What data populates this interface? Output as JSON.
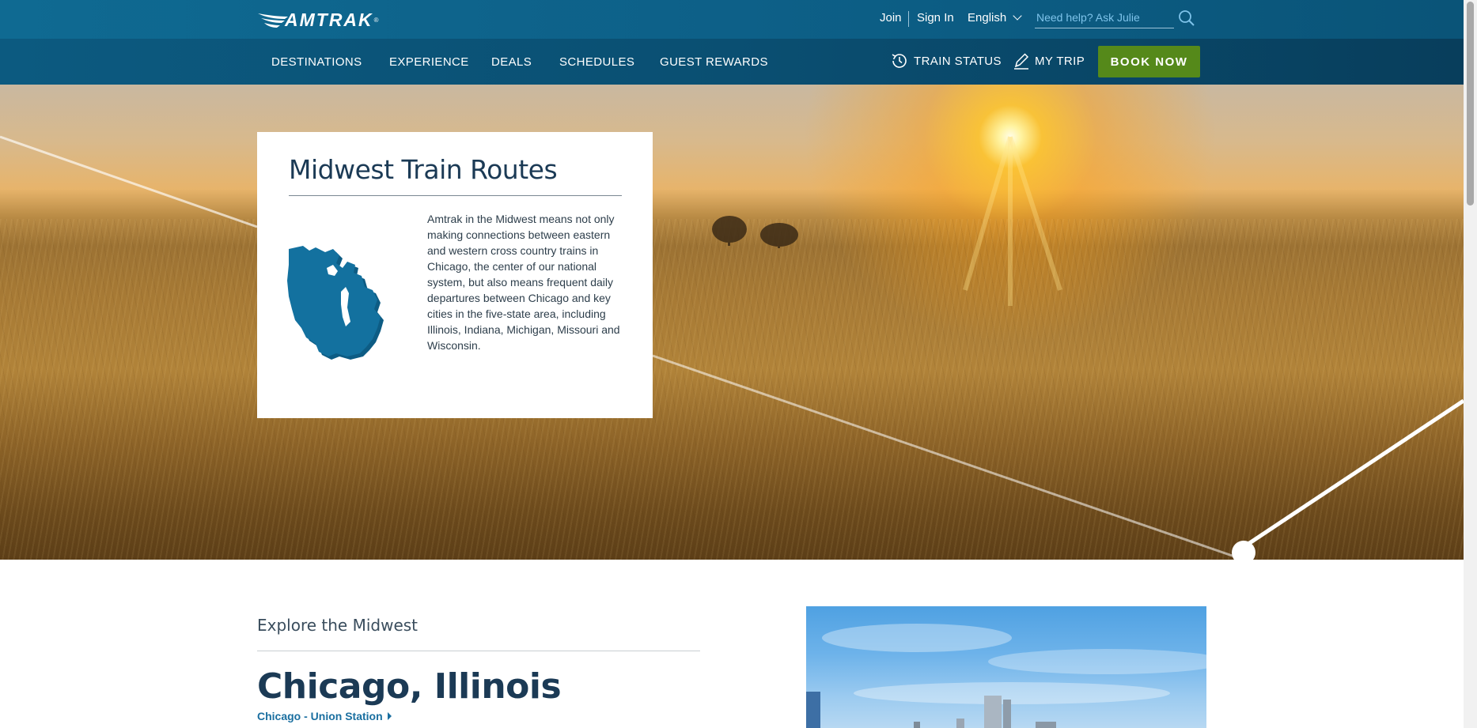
{
  "brand": {
    "name": "AMTRAK",
    "reg": "®"
  },
  "utility": {
    "join": "Join",
    "sign_in": "Sign In",
    "language": "English",
    "search_placeholder": "Need help? Ask Julie"
  },
  "nav": {
    "items": [
      {
        "label": "DESTINATIONS"
      },
      {
        "label": "EXPERIENCE"
      },
      {
        "label": "DEALS"
      },
      {
        "label": "SCHEDULES"
      },
      {
        "label": "GUEST REWARDS"
      }
    ],
    "train_status": "TRAIN STATUS",
    "my_trip": "MY TRIP",
    "book_now": "BOOK NOW"
  },
  "hero": {
    "card_title": "Midwest Train Routes",
    "card_text": "Amtrak in the Midwest means not only making connections between eastern and western cross country trains in Chicago, the center of our national system, but also means frequent daily departures between Chicago and key cities in the five-state area, including Illinois, Indiana, Michigan, Missouri and Wisconsin."
  },
  "explore": {
    "label": "Explore the Midwest",
    "city": "Chicago, Illinois",
    "station_link": "Chicago - Union Station"
  },
  "colors": {
    "top_bar": "#0e6187",
    "nav_bar": "#0a4f72",
    "book_button": "#55891a",
    "map_fill": "#13719f",
    "link": "#1a6fa0",
    "search_placeholder": "#7ec3ea"
  },
  "icons": {
    "logo": "amtrak-swoosh-icon",
    "search": "search-icon",
    "language_caret": "chevron-down-icon",
    "train_status": "clock-history-icon",
    "my_trip": "pencil-icon",
    "map": "midwest-states-map-icon",
    "station_link": "caret-right-icon"
  }
}
